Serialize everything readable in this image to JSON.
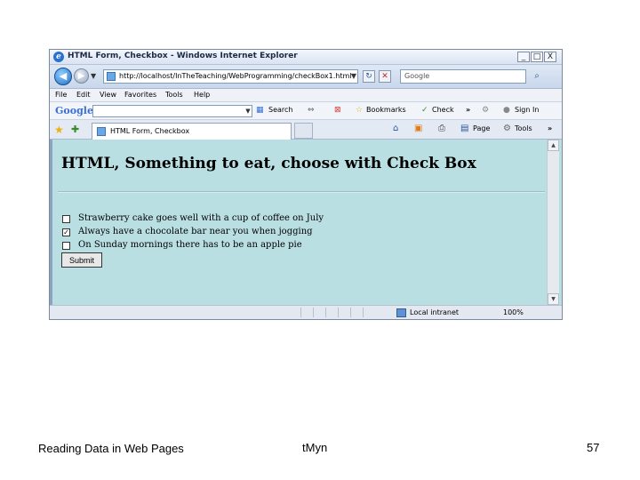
{
  "window": {
    "title": "HTML Form, Checkbox - Windows Internet Explorer",
    "minimize": "_",
    "maximize": "□",
    "close": "X"
  },
  "address": {
    "url": "http://localhost/InTheTeaching/WebProgramming/checkBox1.html",
    "search_placeholder": "Google"
  },
  "menu": [
    "File",
    "Edit",
    "View",
    "Favorites",
    "Tools",
    "Help"
  ],
  "google_toolbar": {
    "logo": "Google",
    "search_label": "Search",
    "bookmarks_label": "Bookmarks",
    "check_label": "Check",
    "signin_label": "Sign In",
    "more": "»"
  },
  "tabs": {
    "active_label": "HTML Form, Checkbox"
  },
  "commands": {
    "page_label": "Page",
    "tools_label": "Tools",
    "more": "»"
  },
  "page": {
    "heading": "HTML, Something to eat, choose with Check Box",
    "checkboxes": [
      {
        "label": "Strawberry cake goes well with a cup of coffee on July",
        "checked": false,
        "mark": ""
      },
      {
        "label": "Always have a chocolate bar near you when jogging",
        "checked": true,
        "mark": "✓"
      },
      {
        "label": "On Sunday mornings there has to be an apple pie",
        "checked": false,
        "mark": ""
      }
    ],
    "submit_label": "Submit"
  },
  "status": {
    "zone": "Local intranet",
    "zoom": "100%"
  },
  "footer": {
    "left": "Reading Data in Web Pages",
    "center": "tMyn",
    "right": "57"
  },
  "colors": {
    "page_background": "#b9dfe3",
    "google_blue": "#3b6fd8",
    "google_red": "#d8342c"
  }
}
